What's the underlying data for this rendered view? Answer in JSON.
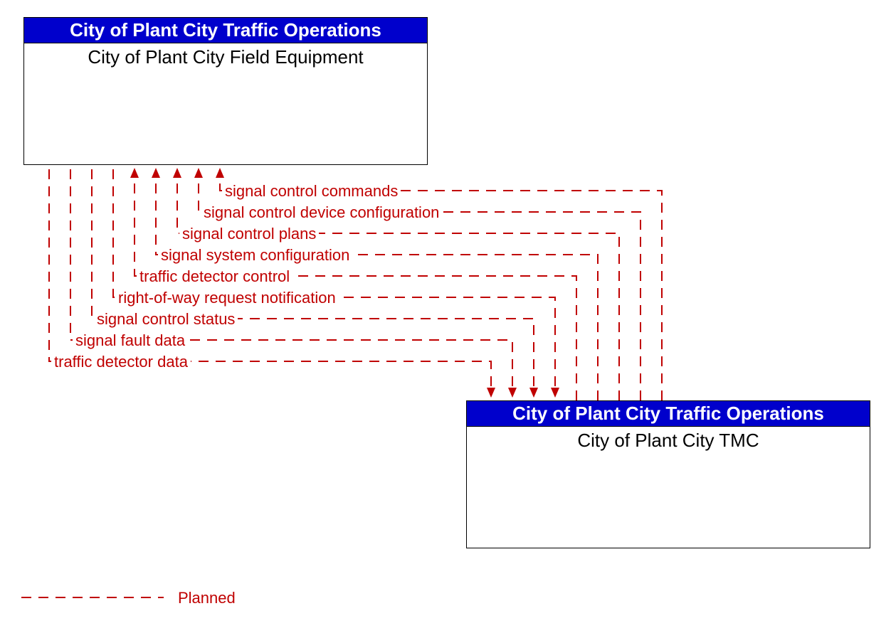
{
  "colors": {
    "planned_line": "#c00000",
    "header_bg": "#0000cc",
    "header_fg": "#ffffff"
  },
  "nodes": {
    "field_equipment": {
      "header": "City of Plant City Traffic Operations",
      "body": "City of Plant City Field Equipment"
    },
    "tmc": {
      "header": "City of Plant City Traffic Operations",
      "body": "City of Plant City TMC"
    }
  },
  "flows": {
    "to_field": [
      "signal control commands",
      "signal control device configuration",
      "signal control plans",
      "signal system configuration",
      "traffic detector control"
    ],
    "to_tmc": [
      "right-of-way request notification",
      "signal control status",
      "signal fault data",
      "traffic detector data"
    ]
  },
  "legend": {
    "planned": "Planned"
  }
}
